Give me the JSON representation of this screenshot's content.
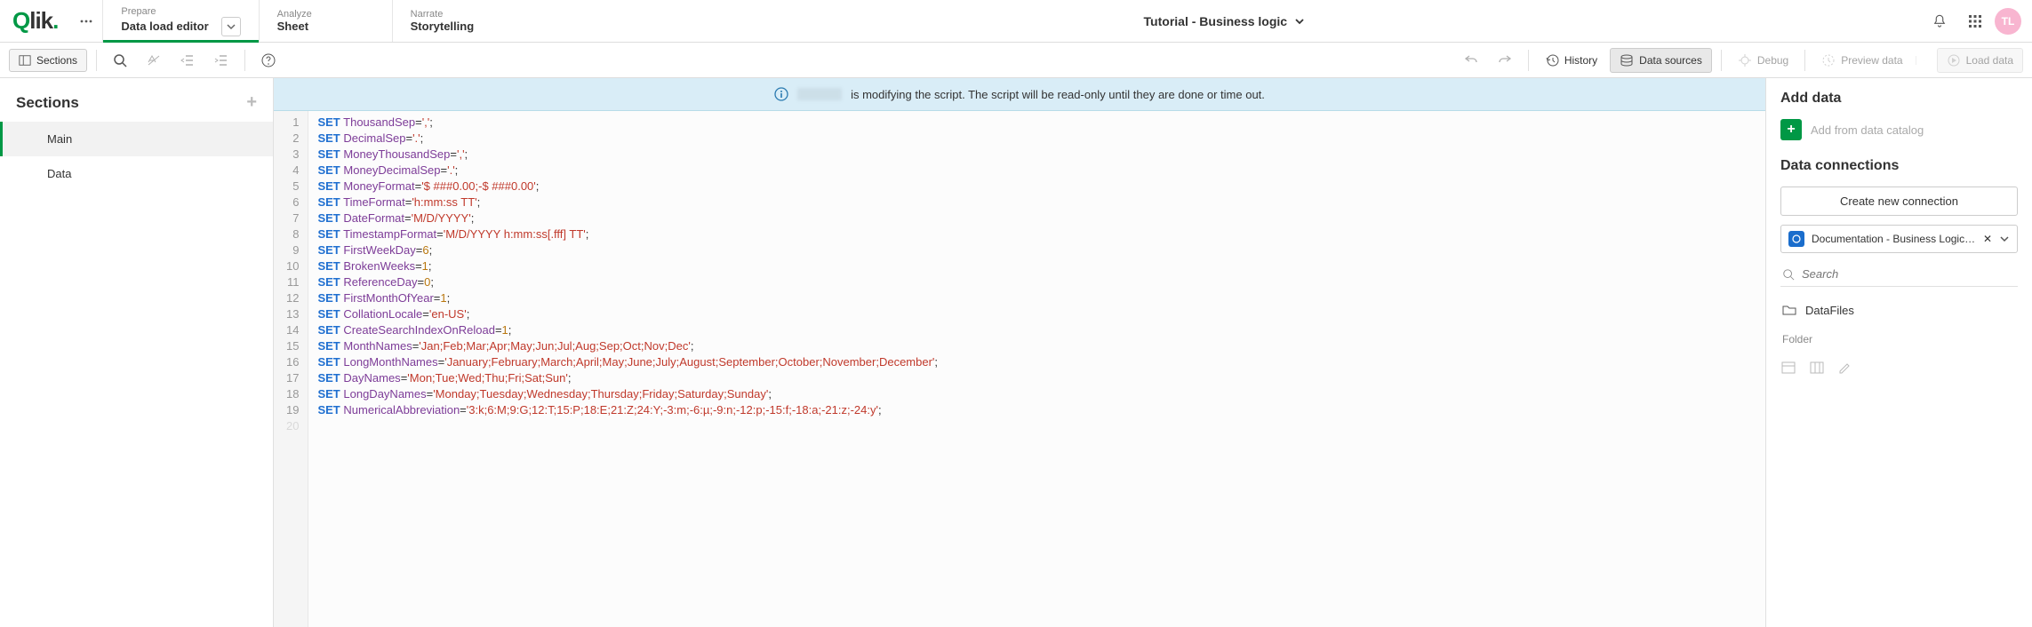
{
  "logo": "Qlik",
  "header": {
    "prepare": {
      "top": "Prepare",
      "bottom": "Data load editor"
    },
    "analyze": {
      "top": "Analyze",
      "bottom": "Sheet"
    },
    "narrate": {
      "top": "Narrate",
      "bottom": "Storytelling"
    },
    "app_title": "Tutorial - Business logic",
    "avatar": "TL"
  },
  "toolbar": {
    "sections": "Sections",
    "history": "History",
    "data_sources": "Data sources",
    "debug": "Debug",
    "preview": "Preview data",
    "load": "Load data"
  },
  "sidebar": {
    "title": "Sections",
    "items": [
      "Main",
      "Data"
    ]
  },
  "banner": {
    "text": "is modifying the script. The script will be read-only until they are done or time out."
  },
  "code": [
    {
      "n": 1,
      "kw": "SET",
      "var": "ThousandSep",
      "eq": "=",
      "val": "','",
      "tail": ";"
    },
    {
      "n": 2,
      "kw": "SET",
      "var": "DecimalSep",
      "eq": "=",
      "val": "'.'",
      "tail": ";"
    },
    {
      "n": 3,
      "kw": "SET",
      "var": "MoneyThousandSep",
      "eq": "=",
      "val": "','",
      "tail": ";"
    },
    {
      "n": 4,
      "kw": "SET",
      "var": "MoneyDecimalSep",
      "eq": "=",
      "val": "'.'",
      "tail": ";"
    },
    {
      "n": 5,
      "kw": "SET",
      "var": "MoneyFormat",
      "eq": "=",
      "val": "'$ ###0.00;-$ ###0.00'",
      "tail": ";"
    },
    {
      "n": 6,
      "kw": "SET",
      "var": "TimeFormat",
      "eq": "=",
      "val": "'h:mm:ss TT'",
      "tail": ";"
    },
    {
      "n": 7,
      "kw": "SET",
      "var": "DateFormat",
      "eq": "=",
      "val": "'M/D/YYYY'",
      "tail": ";"
    },
    {
      "n": 8,
      "kw": "SET",
      "var": "TimestampFormat",
      "eq": "=",
      "val": "'M/D/YYYY h:mm:ss[.fff] TT'",
      "tail": ";"
    },
    {
      "n": 9,
      "kw": "SET",
      "var": "FirstWeekDay",
      "eq": "=",
      "num": "6",
      "tail": ";"
    },
    {
      "n": 10,
      "kw": "SET",
      "var": "BrokenWeeks",
      "eq": "=",
      "num": "1",
      "tail": ";"
    },
    {
      "n": 11,
      "kw": "SET",
      "var": "ReferenceDay",
      "eq": "=",
      "num": "0",
      "tail": ";"
    },
    {
      "n": 12,
      "kw": "SET",
      "var": "FirstMonthOfYear",
      "eq": "=",
      "num": "1",
      "tail": ";"
    },
    {
      "n": 13,
      "kw": "SET",
      "var": "CollationLocale",
      "eq": "=",
      "val": "'en-US'",
      "tail": ";"
    },
    {
      "n": 14,
      "kw": "SET",
      "var": "CreateSearchIndexOnReload",
      "eq": "=",
      "num": "1",
      "tail": ";"
    },
    {
      "n": 15,
      "kw": "SET",
      "var": "MonthNames",
      "eq": "=",
      "val": "'Jan;Feb;Mar;Apr;May;Jun;Jul;Aug;Sep;Oct;Nov;Dec'",
      "tail": ";"
    },
    {
      "n": 16,
      "kw": "SET",
      "var": "LongMonthNames",
      "eq": "=",
      "val": "'January;February;March;April;May;June;July;August;September;October;November;December'",
      "tail": ";"
    },
    {
      "n": 17,
      "kw": "SET",
      "var": "DayNames",
      "eq": "=",
      "val": "'Mon;Tue;Wed;Thu;Fri;Sat;Sun'",
      "tail": ";"
    },
    {
      "n": 18,
      "kw": "SET",
      "var": "LongDayNames",
      "eq": "=",
      "val": "'Monday;Tuesday;Wednesday;Thursday;Friday;Saturday;Sunday'",
      "tail": ";"
    },
    {
      "n": 19,
      "kw": "SET",
      "var": "NumericalAbbreviation",
      "eq": "=",
      "val": "'3:k;6:M;9:G;12:T;15:P;18:E;21:Z;24:Y;-3:m;-6:µ;-9:n;-12:p;-15:f;-18:a;-21:z;-24:y'",
      "tail": ";"
    }
  ],
  "right": {
    "add_data": "Add data",
    "add_catalog": "Add from data catalog",
    "connections": "Data connections",
    "create": "Create new connection",
    "conn_item": "Documentation - Business Logic ...",
    "search_placeholder": "Search",
    "data_files": "DataFiles",
    "folder": "Folder"
  }
}
